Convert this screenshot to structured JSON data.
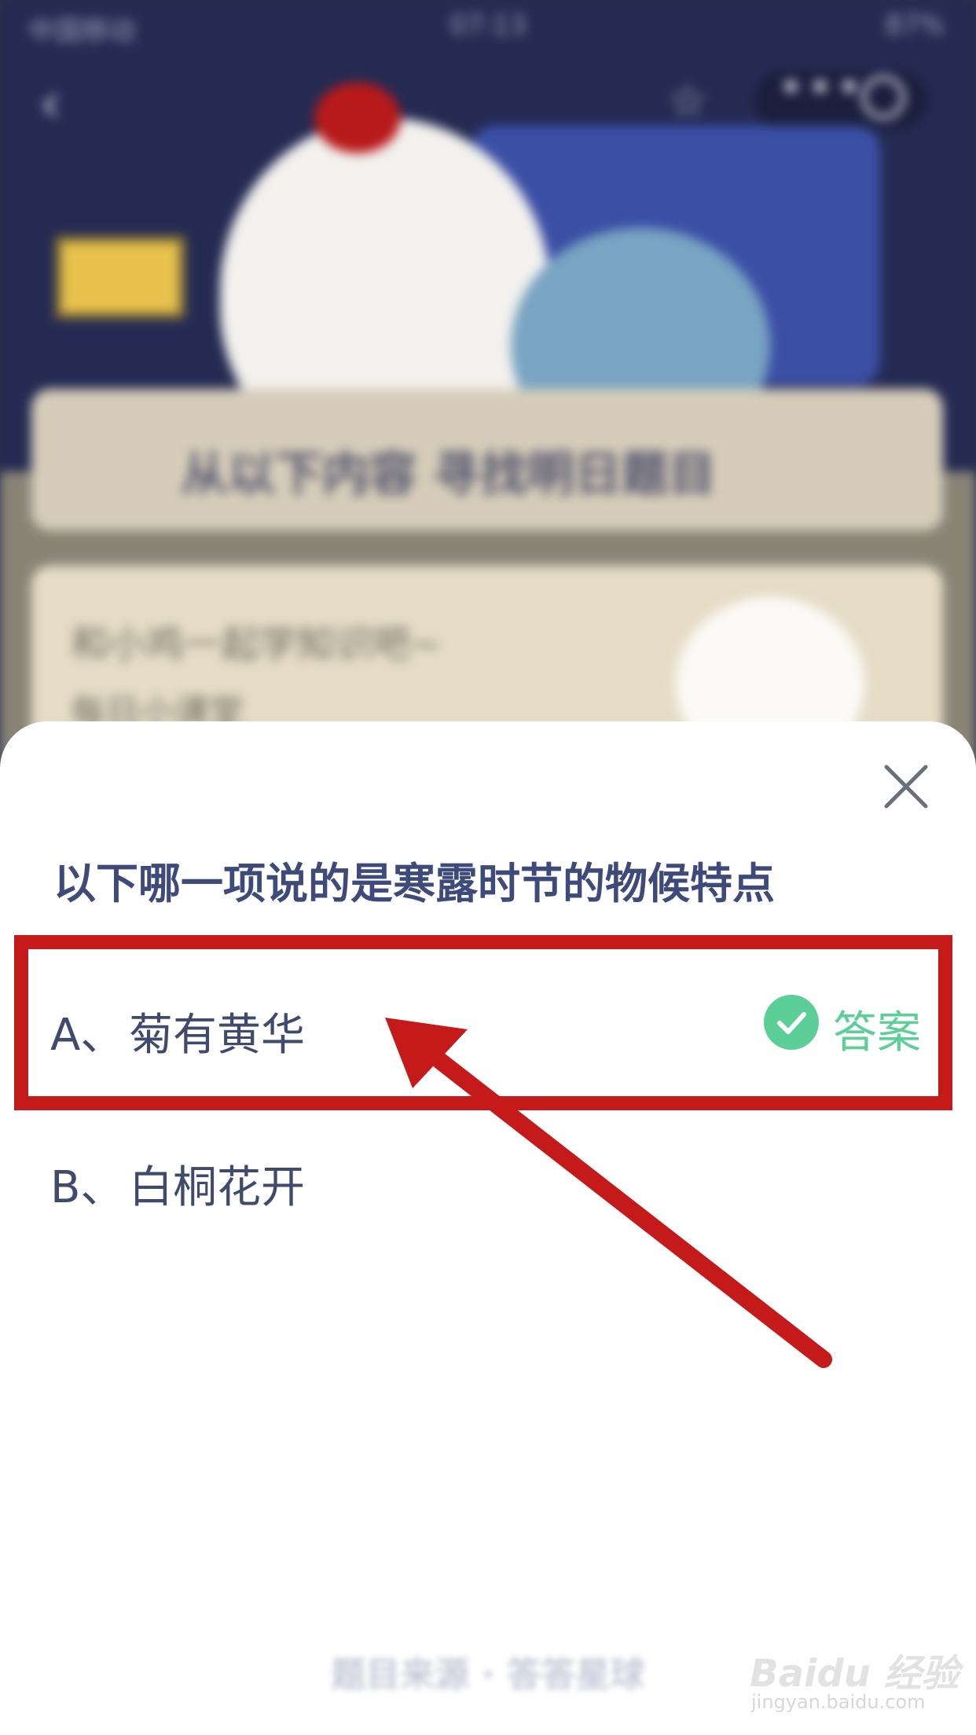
{
  "background": {
    "status_bar": {
      "carrier": "中国移动",
      "time": "07:13",
      "battery": "87%"
    },
    "banner_title": "从以下内容 寻找明日题目",
    "panel_line1": "和小鸡一起学知识吧~",
    "panel_line2": "每日小课堂"
  },
  "quiz": {
    "question": "以下哪一项说的是寒露时节的物候特点",
    "options": [
      {
        "letter": "A、",
        "text": "菊有黄华"
      },
      {
        "letter": "B、",
        "text": "白桐花开"
      }
    ],
    "answer_label": "答案",
    "footer_text": "题目来源 · 答答星球"
  },
  "watermark": {
    "logo": "Baidu 经验",
    "site": "jingyan.baidu.com"
  },
  "colors": {
    "answer_green": "#5ccf98",
    "annotation_red": "#c51a1a",
    "question_text": "#3e4b7a"
  },
  "icons": [
    "back-icon",
    "star-icon",
    "more-icon",
    "target-icon",
    "close-icon",
    "check-icon"
  ]
}
